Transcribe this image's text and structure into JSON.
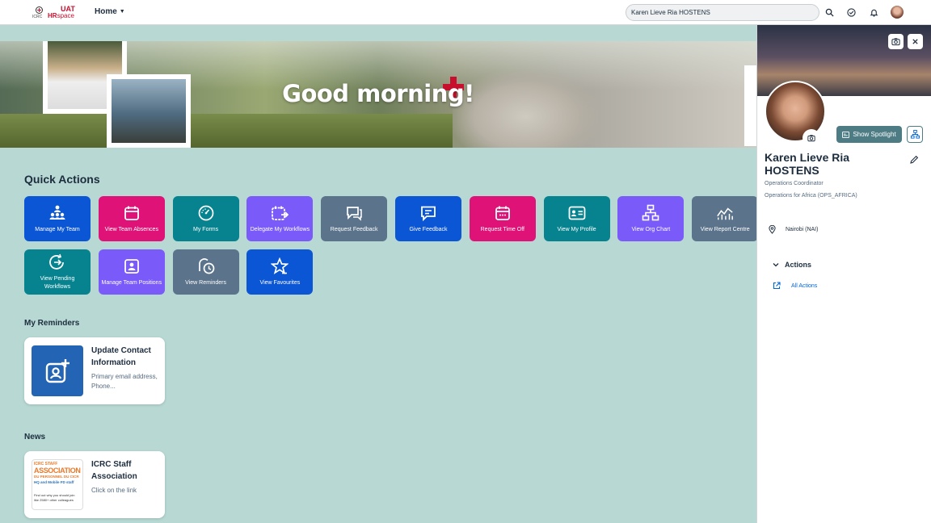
{
  "shell": {
    "logo": {
      "env": "UAT",
      "org": "ICRC",
      "app_prefix": "HR",
      "app_suffix": "space"
    },
    "home_label": "Home",
    "search_value": "Karen Lieve Ria HOSTENS"
  },
  "banner": {
    "greeting": "Good morning!"
  },
  "quick_actions": {
    "title": "Quick Actions",
    "tiles": [
      {
        "label": "Manage My Team",
        "color": "#0b56d4",
        "icon": "team-icon"
      },
      {
        "label": "View Team Absences",
        "color": "#df1277",
        "icon": "calendar-icon"
      },
      {
        "label": "My Forms",
        "color": "#07838f",
        "icon": "gauge-icon"
      },
      {
        "label": "Delegate My Workflows",
        "color": "#7a5af8",
        "icon": "calendar-arrow-icon"
      },
      {
        "label": "Request Feedback",
        "color": "#5b738b",
        "icon": "feedback-icon"
      },
      {
        "label": "Give Feedback",
        "color": "#0b56d4",
        "icon": "message-icon"
      },
      {
        "label": "Request Time Off",
        "color": "#df1277",
        "icon": "calendar-dots-icon"
      },
      {
        "label": "View My Profile",
        "color": "#07838f",
        "icon": "id-card-icon"
      },
      {
        "label": "View Org Chart",
        "color": "#7a5af8",
        "icon": "org-chart-icon"
      },
      {
        "label": "View Report Centre",
        "color": "#5b738b",
        "icon": "line-chart-icon"
      },
      {
        "label": "View Pending Workflows",
        "color": "#07838f",
        "icon": "pending-icon"
      },
      {
        "label": "Manage Team Positions",
        "color": "#7a5af8",
        "icon": "position-icon"
      },
      {
        "label": "View Reminders",
        "color": "#5b738b",
        "icon": "reminder-icon"
      },
      {
        "label": "View Favourites",
        "color": "#0b56d4",
        "icon": "star-icon"
      }
    ]
  },
  "reminders": {
    "title": "My Reminders",
    "card": {
      "title": "Update Contact Information",
      "subtitle": "Primary email address, Phone..."
    }
  },
  "news": {
    "title": "News",
    "card": {
      "title": "ICRC Staff Association",
      "subtitle": "Click on the link",
      "thumb_lines": [
        "ICRC STAFF",
        "ASSOCIATION",
        "DU PERSONNEL DU CICR",
        "HQ and Mobile FD staff",
        "Find out why you should join",
        "like 2580+ other colleagues"
      ]
    }
  },
  "profile_panel": {
    "name": "Karen Lieve Ria HOSTENS",
    "job_title": "Operations Coordinator",
    "department": "Operations for Africa (OPS_AFRICA)",
    "location": "Nairobi (NAI)",
    "spotlight_label": "Show Spotlight",
    "actions_header": "Actions",
    "all_actions_label": "All Actions"
  }
}
